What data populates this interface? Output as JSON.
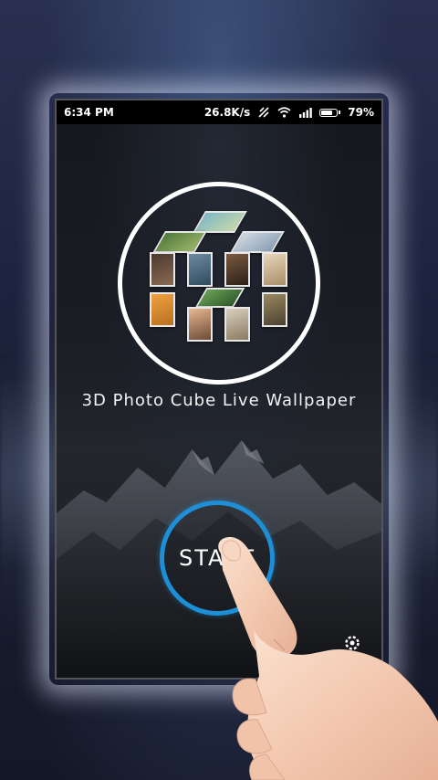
{
  "status_bar": {
    "time": "6:34 PM",
    "net_speed": "26.8K/s",
    "battery_percent": "79%",
    "battery_level": 0.79
  },
  "app": {
    "title": "3D Photo Cube Live Wallpaper",
    "start_label": "START"
  },
  "icons": {
    "data_saver": "data-saver-icon",
    "wifi": "wifi-icon",
    "signal": "signal-icon",
    "battery": "battery-icon",
    "settings": "gear-icon",
    "hand": "pointing-hand"
  },
  "colors": {
    "accent": "#1e8fd6",
    "status_bar_bg": "#000000",
    "circle": "#ffffff"
  }
}
